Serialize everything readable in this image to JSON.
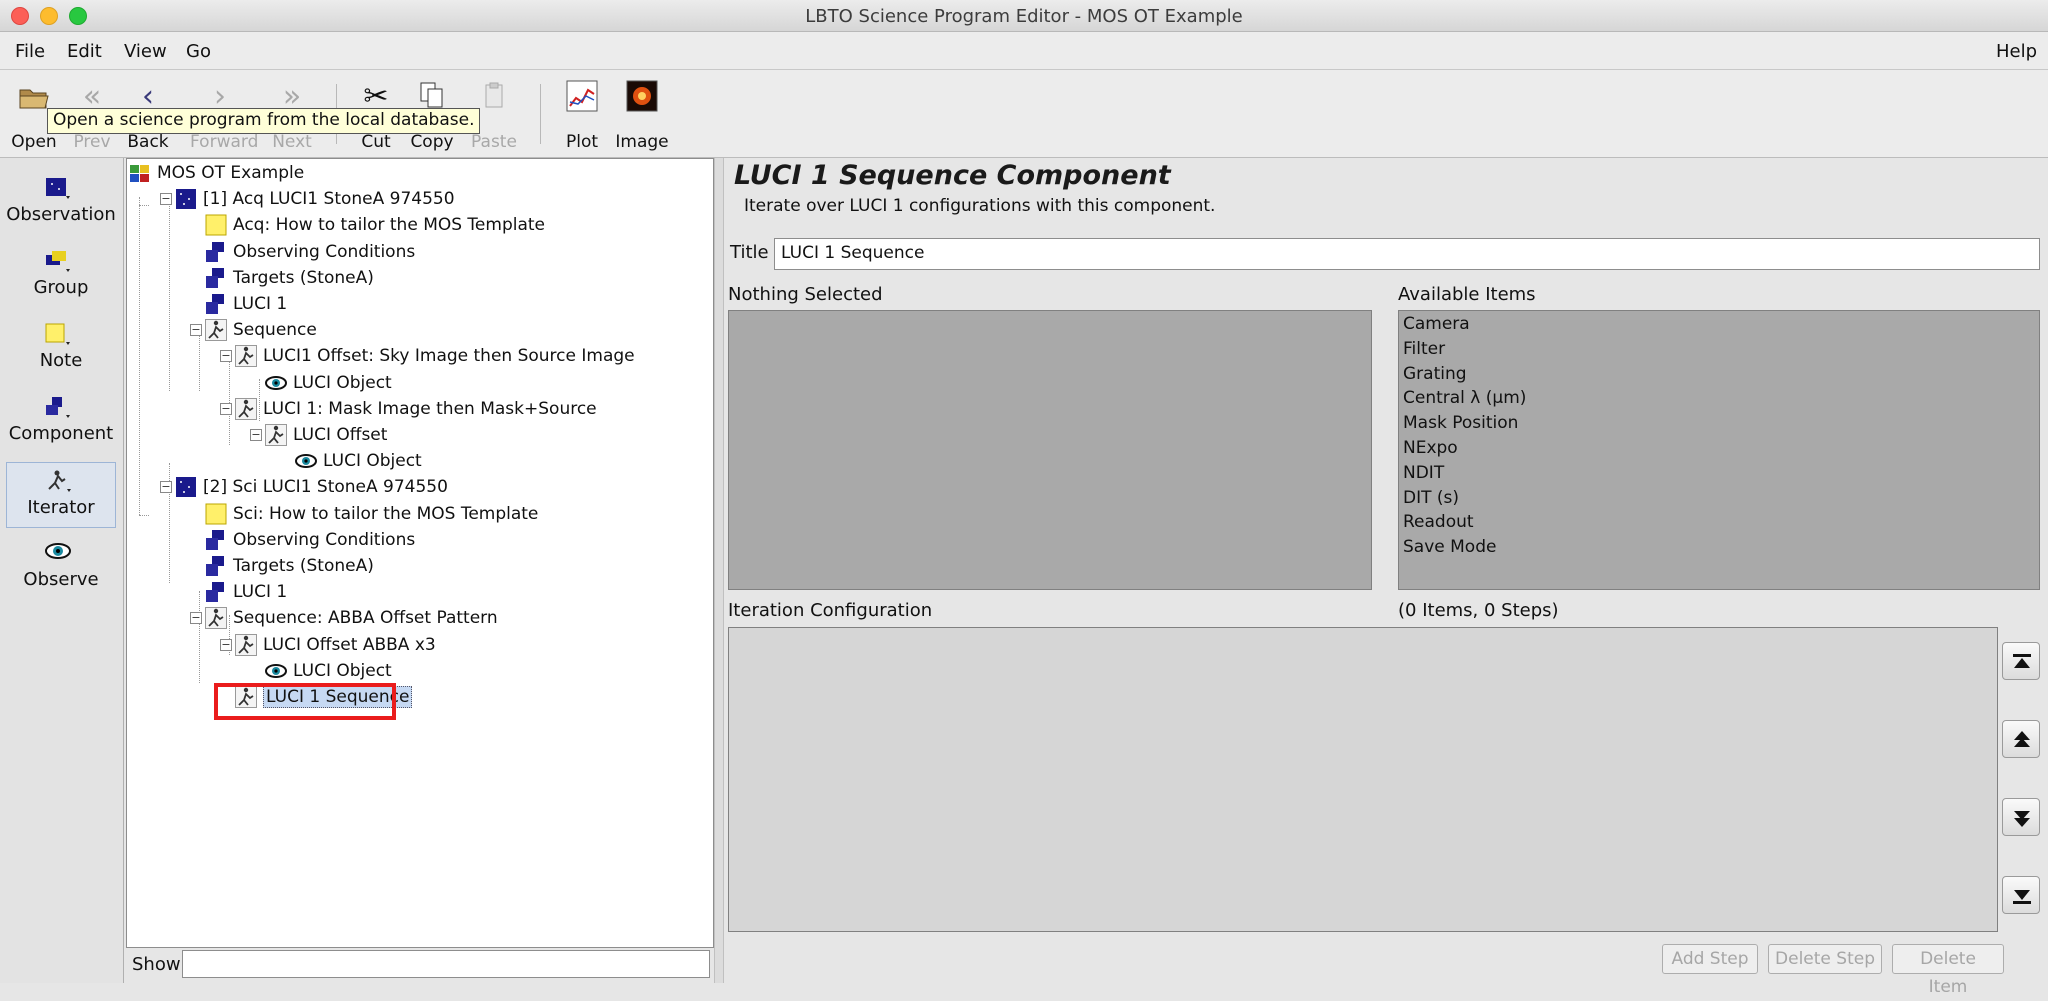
{
  "window": {
    "title": "LBTO Science Program Editor - MOS OT Example"
  },
  "menubar": {
    "items": [
      "File",
      "Edit",
      "View",
      "Go"
    ],
    "help": "Help"
  },
  "toolbar": {
    "buttons": [
      {
        "label": "Open",
        "icon": "folder-icon",
        "enabled": true
      },
      {
        "label": "Prev",
        "icon": "double-chevron-left-icon",
        "enabled": false
      },
      {
        "label": "Back",
        "icon": "chevron-left-icon",
        "enabled": true
      },
      {
        "label": "Forward",
        "icon": "chevron-right-icon",
        "enabled": false
      },
      {
        "label": "Next",
        "icon": "double-chevron-right-icon",
        "enabled": false
      },
      {
        "label": "Cut",
        "icon": "scissors-icon",
        "enabled": true
      },
      {
        "label": "Copy",
        "icon": "copy-icon",
        "enabled": true
      },
      {
        "label": "Paste",
        "icon": "clipboard-icon",
        "enabled": false
      },
      {
        "label": "Plot",
        "icon": "plot-icon",
        "enabled": true
      },
      {
        "label": "Image",
        "icon": "image-icon",
        "enabled": true
      }
    ],
    "tooltip": "Open a science program from the local database."
  },
  "palette": {
    "items": [
      {
        "label": "Observation",
        "icon": "observation-icon"
      },
      {
        "label": "Group",
        "icon": "group-icon"
      },
      {
        "label": "Note",
        "icon": "note-icon"
      },
      {
        "label": "Component",
        "icon": "component-icon"
      },
      {
        "label": "Iterator",
        "icon": "iterator-icon",
        "active": true
      },
      {
        "label": "Observe",
        "icon": "eye-icon"
      }
    ]
  },
  "tree": {
    "nodes": [
      {
        "label": "MOS OT Example",
        "icon": "program-icon"
      },
      {
        "label": "[1] Acq LUCI1 StoneA 974550",
        "icon": "observation-icon"
      },
      {
        "label": "Acq: How to tailor the MOS Template",
        "icon": "note-icon"
      },
      {
        "label": "Observing Conditions",
        "icon": "component-icon"
      },
      {
        "label": "Targets (StoneA)",
        "icon": "component-icon"
      },
      {
        "label": "LUCI 1",
        "icon": "component-icon"
      },
      {
        "label": "Sequence",
        "icon": "iterator-icon"
      },
      {
        "label": "LUCI1 Offset: Sky Image then Source Image",
        "icon": "iterator-icon"
      },
      {
        "label": "LUCI Object",
        "icon": "eye-icon"
      },
      {
        "label": "LUCI 1: Mask Image then Mask+Source",
        "icon": "iterator-icon"
      },
      {
        "label": "LUCI Offset",
        "icon": "iterator-icon"
      },
      {
        "label": "LUCI Object",
        "icon": "eye-icon"
      },
      {
        "label": "[2] Sci LUCI1 StoneA 974550",
        "icon": "observation-icon"
      },
      {
        "label": "Sci: How to tailor the MOS Template",
        "icon": "note-icon"
      },
      {
        "label": "Observing Conditions",
        "icon": "component-icon"
      },
      {
        "label": "Targets (StoneA)",
        "icon": "component-icon"
      },
      {
        "label": "LUCI 1",
        "icon": "component-icon"
      },
      {
        "label": "Sequence: ABBA Offset Pattern",
        "icon": "iterator-icon"
      },
      {
        "label": "LUCI Offset ABBA x3",
        "icon": "iterator-icon"
      },
      {
        "label": "LUCI Object",
        "icon": "eye-icon"
      },
      {
        "label": "LUCI 1 Sequence",
        "icon": "iterator-icon",
        "selected": true
      }
    ],
    "show_label": "Show",
    "show_value": ""
  },
  "editor": {
    "heading": "LUCI 1 Sequence Component",
    "description": "Iterate over LUCI 1 configurations with this component.",
    "title_label": "Title",
    "title_value": "LUCI 1 Sequence",
    "nothing_selected": "Nothing Selected",
    "available_label": "Available Items",
    "available_items": [
      "Camera",
      "Filter",
      "Grating",
      "Central λ (µm)",
      "Mask Position",
      "NExpo",
      "NDIT",
      "DIT (s)",
      "Readout",
      "Save Mode"
    ],
    "iteration_label": "Iteration Configuration",
    "iteration_count": "(0 Items, 0 Steps)",
    "buttons": {
      "add_step": "Add Step",
      "delete_step": "Delete Step",
      "delete_item": "Delete Item"
    }
  },
  "colors": {
    "selection_outline": "#ea1c1c",
    "selection_fill": "#c6d9f3",
    "listbox_bg": "#a9a9a9"
  }
}
